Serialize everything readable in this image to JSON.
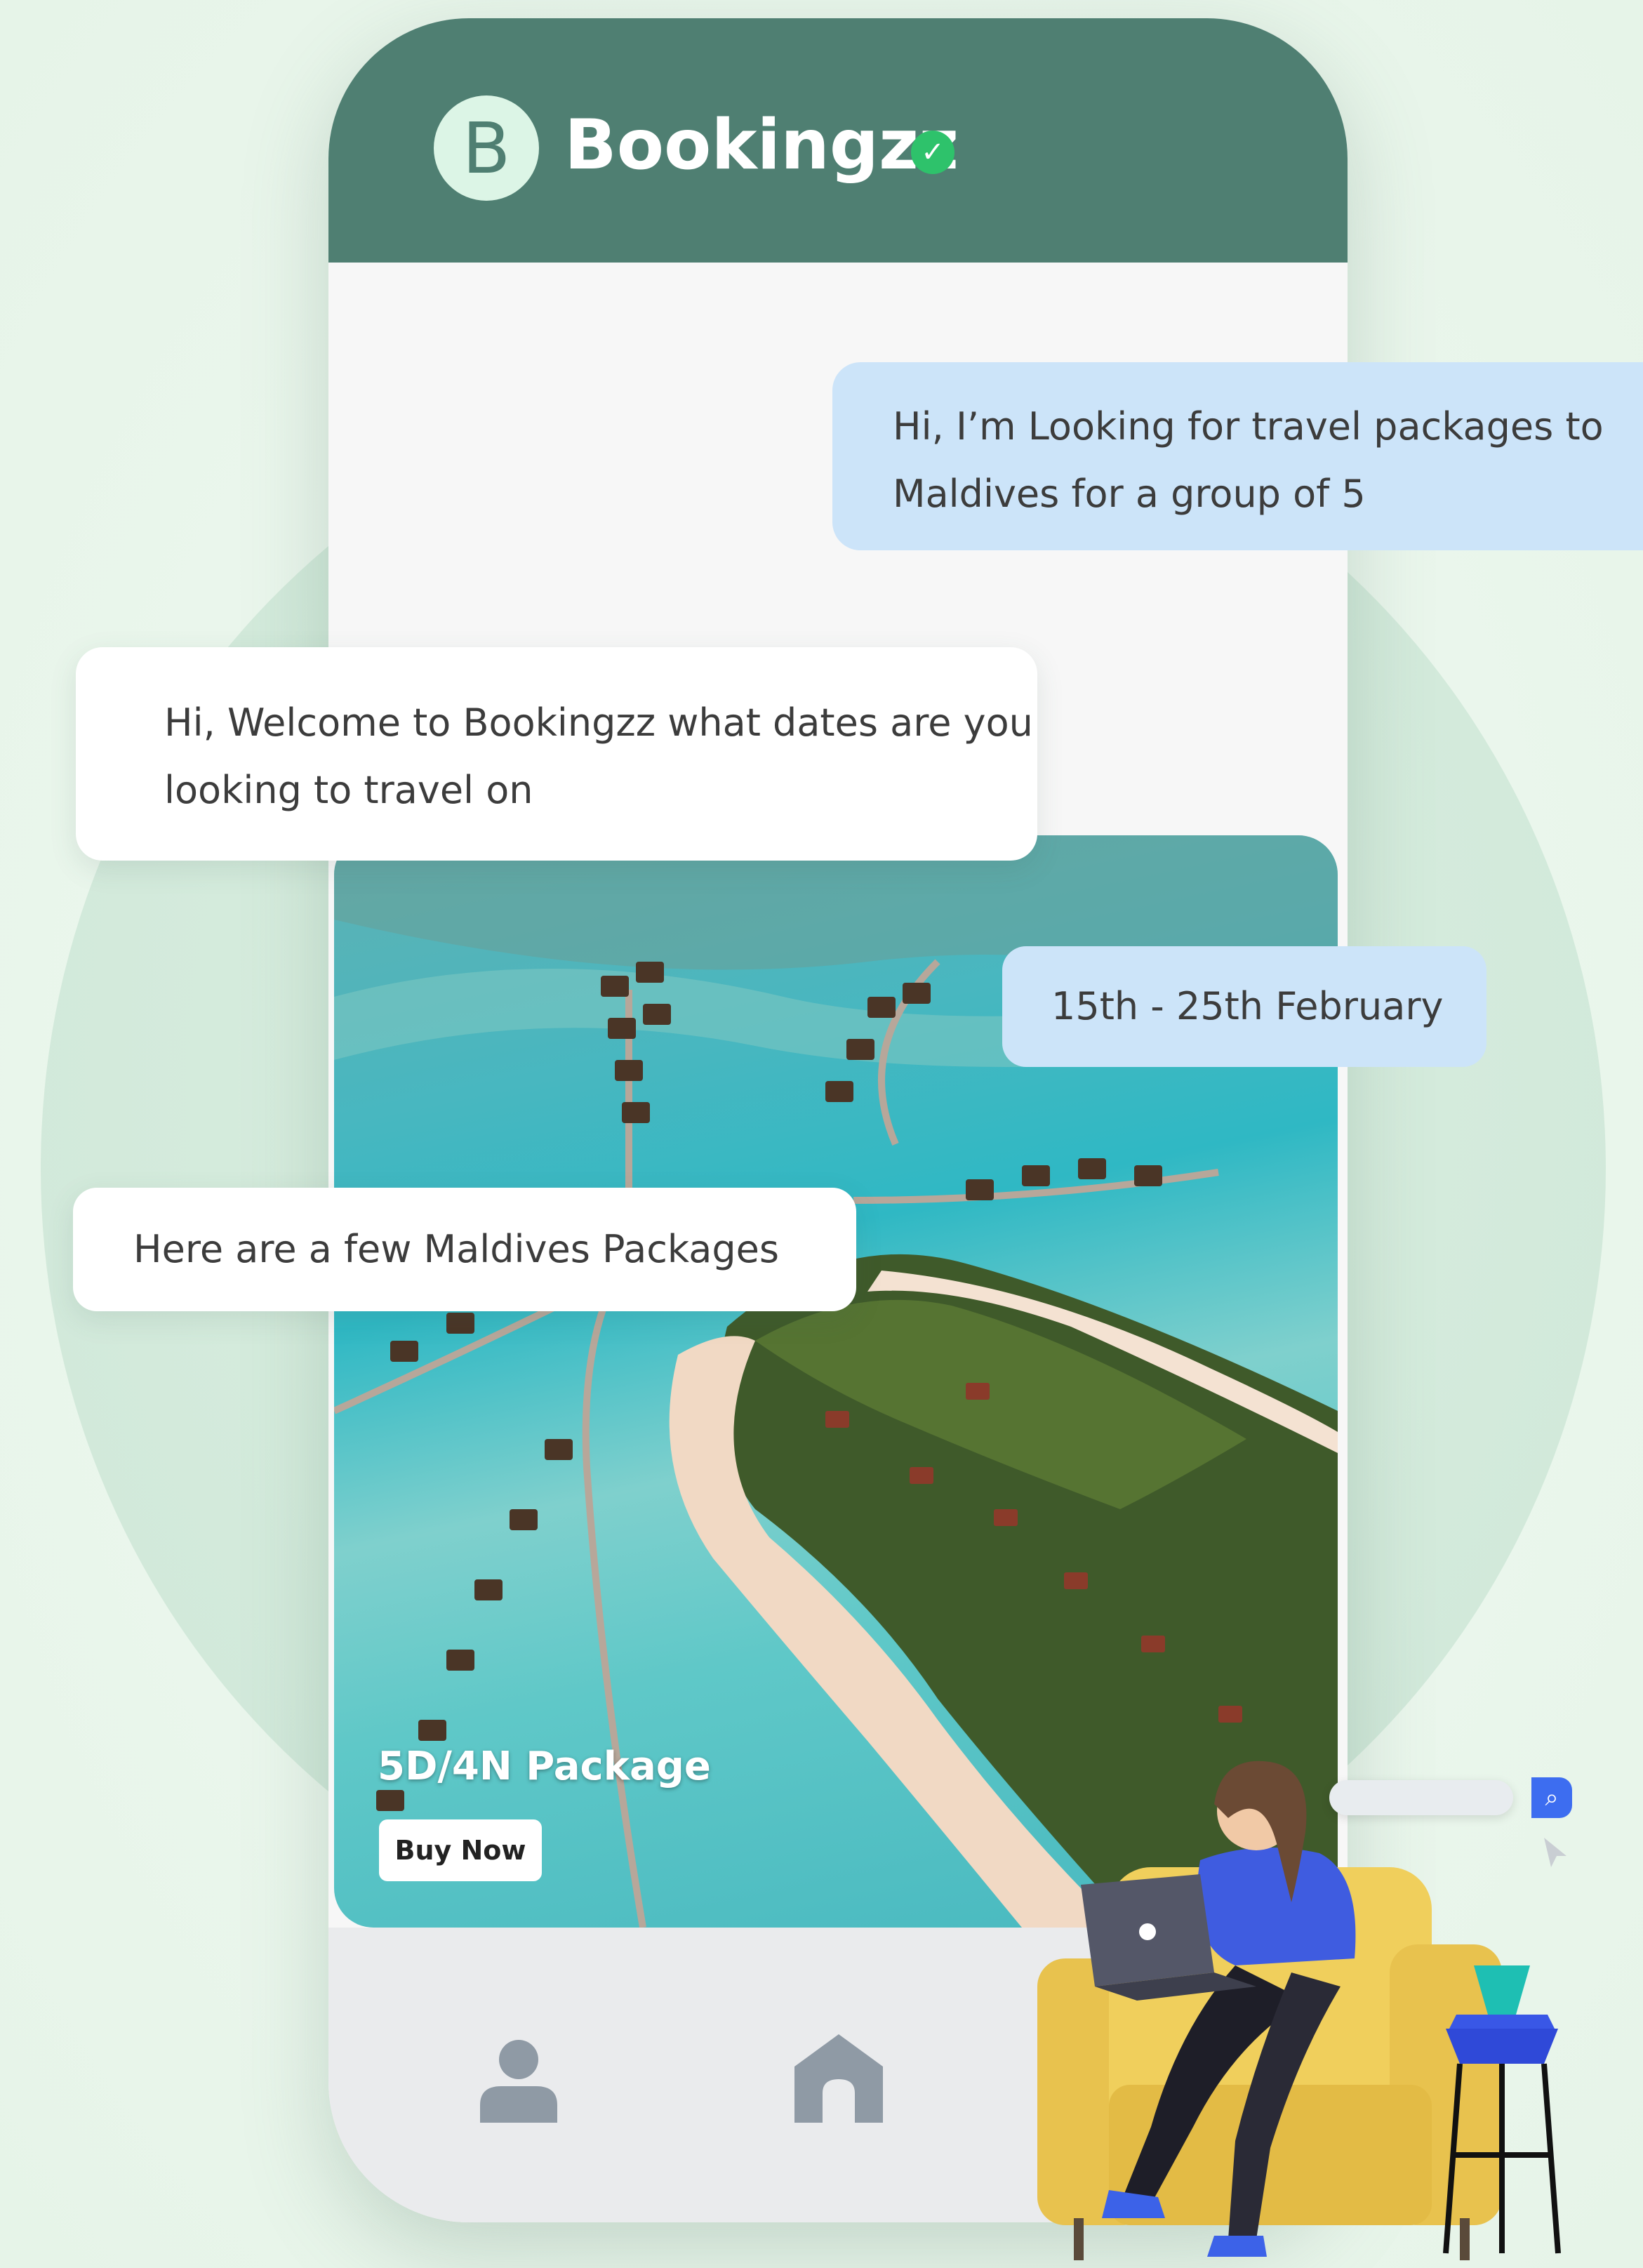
{
  "app": {
    "logo_letter": "B",
    "brand_name": "Bookingzz"
  },
  "messages": [
    {
      "sender": "user",
      "text": "Hi, I’m Looking for travel packages to Maldives for a group of 5"
    },
    {
      "sender": "bot",
      "text": "Hi, Welcome to Bookingzz what dates are you looking to travel on"
    },
    {
      "sender": "user",
      "text": "15th - 25th February"
    },
    {
      "sender": "bot",
      "text": "Here are a few Maldives Packages"
    }
  ],
  "package_card": {
    "title": "5D/4N Package",
    "cta_label": "Buy Now"
  },
  "nav": {
    "items": [
      {
        "icon": "user-icon"
      },
      {
        "icon": "home-icon"
      }
    ]
  },
  "colors": {
    "header": "#4f7f72",
    "user_bubble": "#cce4f9",
    "bot_bubble": "#ffffff",
    "verified": "#2ec26b",
    "search_button": "#3d6df0"
  }
}
